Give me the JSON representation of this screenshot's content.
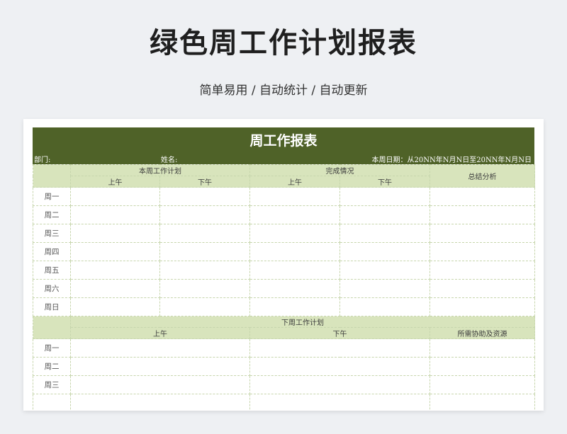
{
  "page": {
    "title": "绿色周工作计划报表",
    "subtitle": "简单易用  /  自动统计  /  自动更新"
  },
  "sheet": {
    "title": "周工作报表",
    "dept_label": "部门:",
    "name_label": "姓名:",
    "date_label": "本周日期：从20NN年N月N日至20NN年N月N日",
    "this_week": {
      "plan_header": "本周工作计划",
      "status_header": "完成情况",
      "summary_header": "总结分析",
      "am": "上午",
      "pm": "下午",
      "days": [
        "周一",
        "周二",
        "周三",
        "周四",
        "周五",
        "周六",
        "周日"
      ]
    },
    "next_week": {
      "plan_header": "下周工作计划",
      "am": "上午",
      "pm": "下午",
      "resources_header": "所需协助及资源",
      "days": [
        "周一",
        "周二",
        "周三"
      ]
    }
  }
}
